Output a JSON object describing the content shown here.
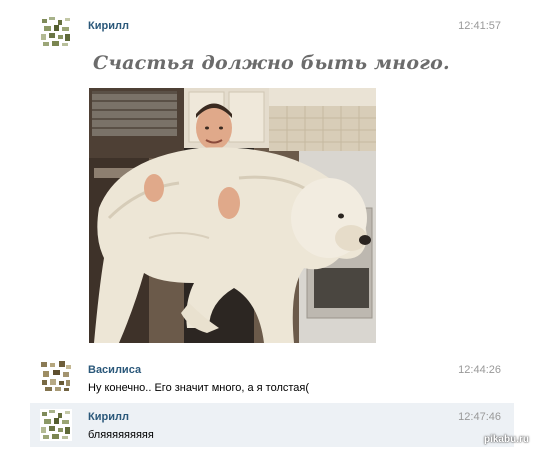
{
  "messages": [
    {
      "author": "Кирилл",
      "time": "12:41:57",
      "caption": "Счастья должно быть много.",
      "photo": "photo of a man holding a large white dog in a kitchen"
    },
    {
      "author": "Василиса",
      "time": "12:44:26",
      "text": "Ну конечно.. Его значит много, а я толстая("
    },
    {
      "author": "Кирилл",
      "time": "12:47:46",
      "text": "бляяяяяяяяя"
    }
  ],
  "watermark": "pikabu.ru",
  "colors": {
    "author": "#2b587a",
    "time": "#999999",
    "highlight_bg": "#edf1f5"
  }
}
